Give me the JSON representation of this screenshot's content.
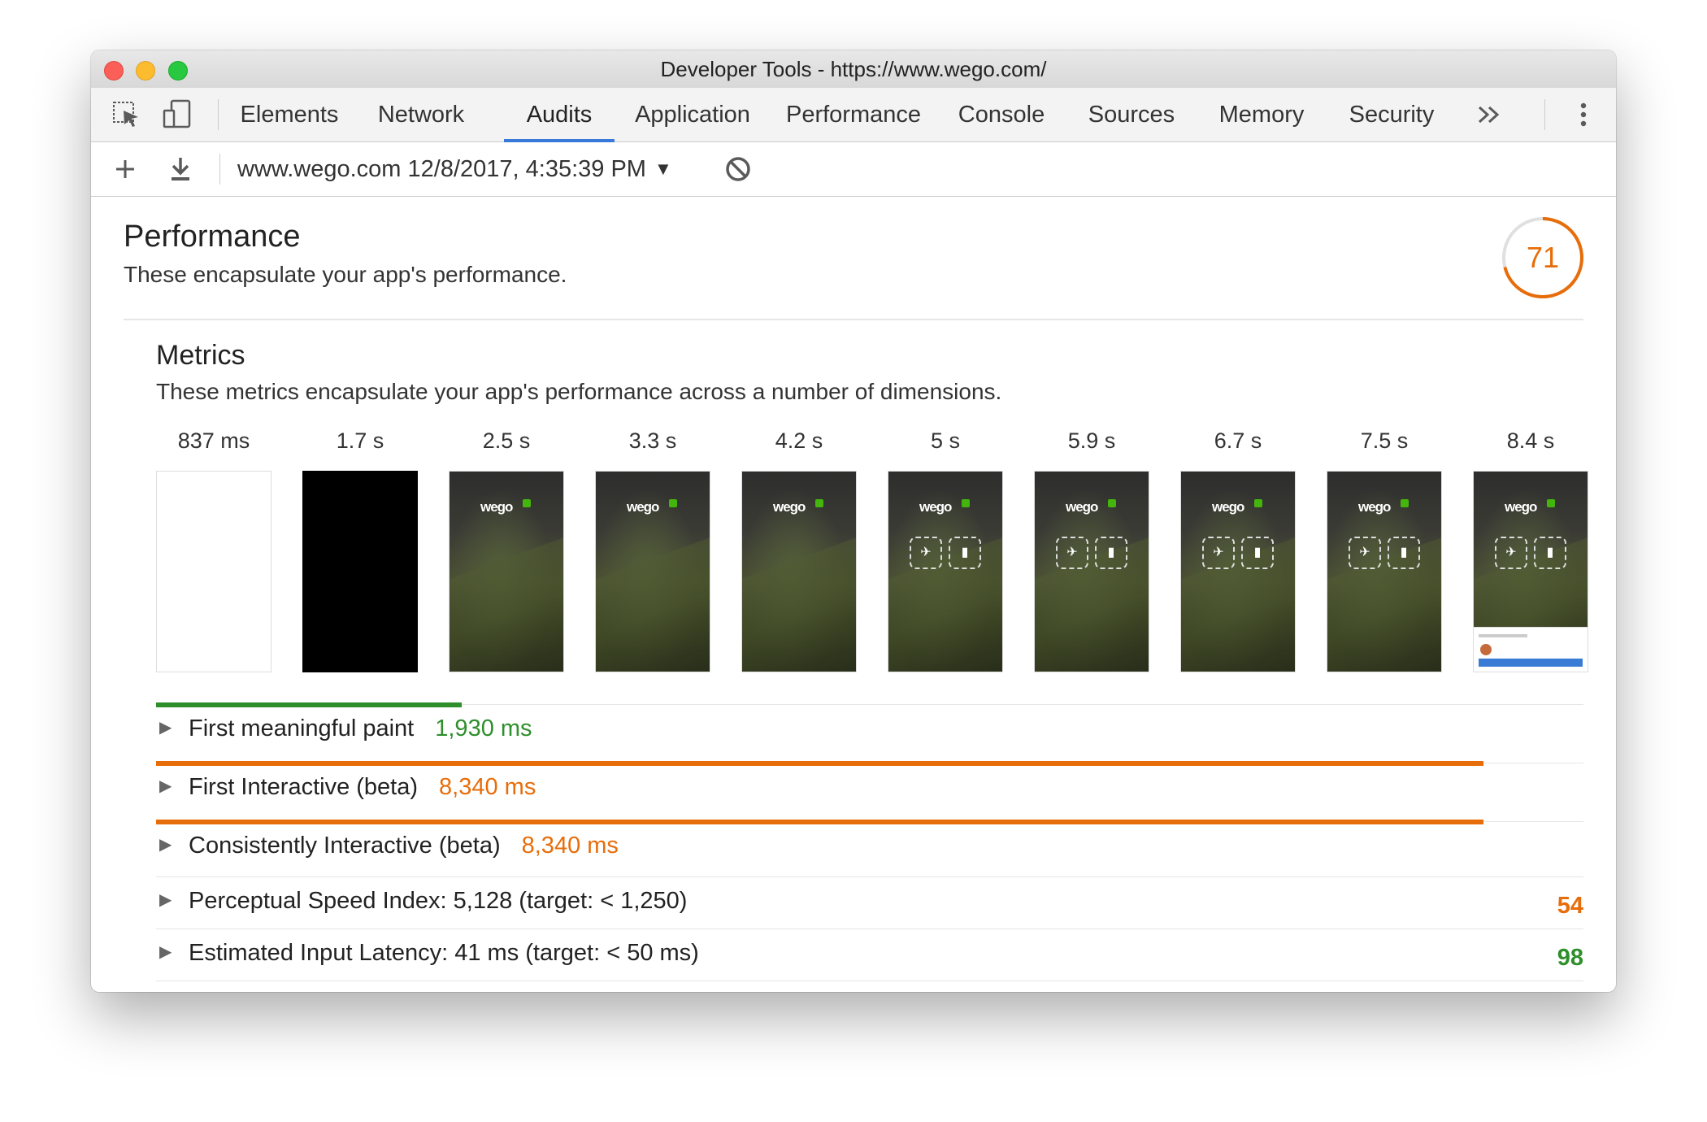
{
  "window": {
    "title": "Developer Tools - https://www.wego.com/"
  },
  "tabs": [
    {
      "label": "Elements"
    },
    {
      "label": "Network"
    },
    {
      "label": "Audits",
      "active": true
    },
    {
      "label": "Application"
    },
    {
      "label": "Performance"
    },
    {
      "label": "Console"
    },
    {
      "label": "Sources"
    },
    {
      "label": "Memory"
    },
    {
      "label": "Security"
    }
  ],
  "tab_overflow_icon": "double-chevron-right-icon",
  "menu_icon": "vertical-ellipsis-icon",
  "toolbar": {
    "report": "www.wego.com 12/8/2017, 4:35:39 PM",
    "icons": [
      "plus-icon",
      "download-icon",
      "clear-icon"
    ]
  },
  "category": {
    "title": "Performance",
    "description": "These encapsulate your app's performance.",
    "score": "71",
    "score_fraction": 0.71,
    "score_color": "#e76d0a"
  },
  "metrics": {
    "title": "Metrics",
    "description": "These metrics encapsulate your app's performance across a number of dimensions.",
    "frames": [
      {
        "time": "837 ms",
        "kind": "blank"
      },
      {
        "time": "1.7 s",
        "kind": "black"
      },
      {
        "time": "2.5 s",
        "kind": "hero"
      },
      {
        "time": "3.3 s",
        "kind": "hero"
      },
      {
        "time": "4.2 s",
        "kind": "hero"
      },
      {
        "time": "5 s",
        "kind": "buttons"
      },
      {
        "time": "5.9 s",
        "kind": "buttons"
      },
      {
        "time": "6.7 s",
        "kind": "buttons"
      },
      {
        "time": "7.5 s",
        "kind": "buttons"
      },
      {
        "time": "8.4 s",
        "kind": "final"
      }
    ],
    "frame_logo_text": "wego",
    "rows": [
      {
        "label": "First meaningful paint",
        "value": "1,930 ms",
        "color": "#2e8f2b",
        "bar_fraction": 0.23
      },
      {
        "label": "First Interactive (beta)",
        "value": "8,340 ms",
        "color": "#e76d0a",
        "bar_fraction": 0.998
      },
      {
        "label": "Consistently Interactive (beta)",
        "value": "8,340 ms",
        "color": "#e76d0a",
        "bar_fraction": 0.998
      }
    ],
    "score_rows": [
      {
        "label": "Perceptual Speed Index: 5,128 (target: < 1,250)",
        "score": "54",
        "color": "#e76d0a"
      },
      {
        "label": "Estimated Input Latency: 41 ms (target: < 50 ms)",
        "score": "98",
        "color": "#2e8f2b"
      }
    ]
  }
}
